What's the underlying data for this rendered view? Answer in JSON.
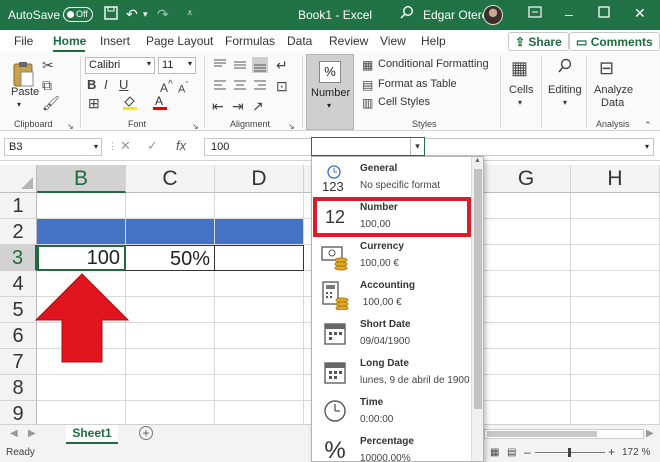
{
  "titlebar": {
    "autosave_label": "AutoSave",
    "autosave_state": "Off",
    "doc_title": "Book1  -  Excel",
    "user_name": "Edgar Otero"
  },
  "tabs": [
    "File",
    "Home",
    "Insert",
    "Page Layout",
    "Formulas",
    "Data",
    "Review",
    "View",
    "Help"
  ],
  "actions": {
    "share": "Share",
    "comments": "Comments"
  },
  "ribbon": {
    "clipboard": {
      "paste": "Paste",
      "group": "Clipboard"
    },
    "font": {
      "name": "Calibri",
      "size": "11",
      "group": "Font"
    },
    "alignment": {
      "group": "Alignment"
    },
    "number": {
      "label": "Number"
    },
    "styles": {
      "conditional": "Conditional Formatting",
      "format_table": "Format as Table",
      "cell_styles": "Cell Styles",
      "group": "Styles"
    },
    "cells": {
      "label": "Cells"
    },
    "editing": {
      "label": "Editing"
    },
    "analysis": {
      "label1": "Analyze",
      "label2": "Data",
      "group": "Analysis"
    }
  },
  "formula_bar": {
    "name_box": "B3",
    "fx": "fx",
    "value": "100"
  },
  "grid": {
    "columns": [
      "B",
      "C",
      "D",
      "",
      "",
      "G",
      "H"
    ],
    "rows": [
      "1",
      "2",
      "3",
      "4",
      "5",
      "6",
      "7",
      "8",
      "9"
    ],
    "cells": {
      "B3": "100",
      "C3": "50%"
    },
    "fill_color": "#4472c4"
  },
  "sheets": {
    "active": "Sheet1"
  },
  "status": {
    "ready": "Ready",
    "zoom": "172 %"
  },
  "number_format_dropdown": {
    "value": "",
    "items": [
      {
        "name": "General",
        "sample": "No specific format",
        "icon": "general-123-icon"
      },
      {
        "name": "Number",
        "sample": "100,00",
        "icon": "number-12-icon"
      },
      {
        "name": "Currency",
        "sample": "100,00 €",
        "icon": "currency-icon"
      },
      {
        "name": "Accounting",
        "sample": " 100,00 €",
        "icon": "accounting-icon"
      },
      {
        "name": "Short Date",
        "sample": "09/04/1900",
        "icon": "calendar-icon"
      },
      {
        "name": "Long Date",
        "sample": "lunes, 9 de abril de 1900",
        "icon": "calendar-icon"
      },
      {
        "name": "Time",
        "sample": "0:00:00",
        "icon": "clock-icon"
      },
      {
        "name": "Percentage",
        "sample": "10000,00%",
        "icon": "percent-icon"
      }
    ],
    "highlight_color": "#d91d2b"
  },
  "colors": {
    "excel_green": "#217346",
    "accent_text": "#1e6b40",
    "arrow_red": "#e0151d"
  }
}
